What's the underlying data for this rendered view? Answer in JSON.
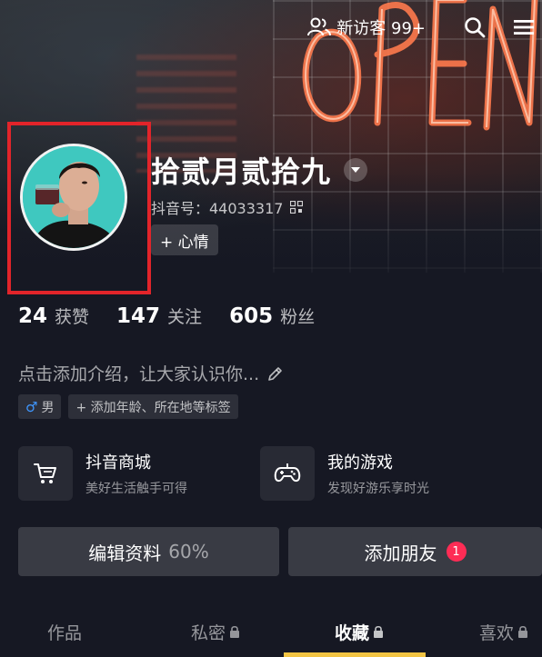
{
  "topbar": {
    "visitors_label": "新访客 99+",
    "visitors_icon": "people-icon",
    "search_icon": "search-icon",
    "menu_icon": "menu-icon"
  },
  "profile": {
    "nickname": "拾贰月贰拾九",
    "id_label": "抖音号：44033317",
    "mood_label": "+ 心情"
  },
  "stats": [
    {
      "num": "24",
      "label": "获赞"
    },
    {
      "num": "147",
      "label": "关注"
    },
    {
      "num": "605",
      "label": "粉丝"
    }
  ],
  "bio": {
    "placeholder": "点击添加介绍，让大家认识你..."
  },
  "tags": {
    "gender_symbol": "♂",
    "gender": "男",
    "add_tags": "+ 添加年龄、所在地等标签"
  },
  "cards": [
    {
      "title": "抖音商城",
      "sub": "美好生活触手可得",
      "icon": "cart-icon"
    },
    {
      "title": "我的游戏",
      "sub": "发现好游乐享时光",
      "icon": "gamepad-icon"
    }
  ],
  "buttons": {
    "edit_profile": "编辑资料",
    "edit_percent": "60%",
    "add_friends": "添加朋友",
    "add_friends_badge": "1"
  },
  "tabs": [
    {
      "label": "作品",
      "locked": false
    },
    {
      "label": "私密",
      "locked": true
    },
    {
      "label": "收藏",
      "locked": true,
      "active": true
    },
    {
      "label": "喜欢",
      "locked": true
    }
  ],
  "colors": {
    "background": "#161823",
    "highlight_frame": "#e2242a",
    "badge": "#fe2c55",
    "tab_indicator": "#f2c443"
  }
}
